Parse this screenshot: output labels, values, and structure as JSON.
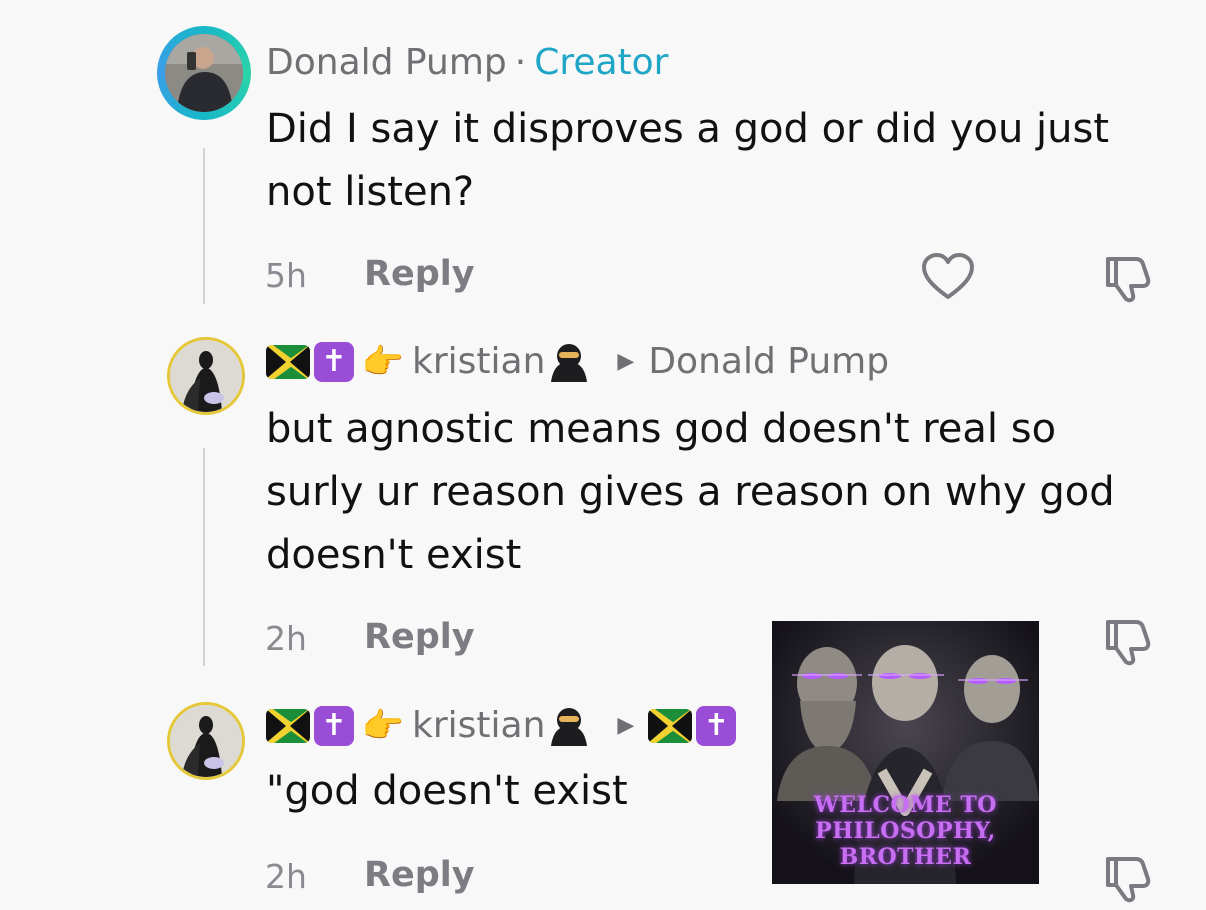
{
  "comments": [
    {
      "author": "Donald Pump",
      "separator": "·",
      "badge": "Creator",
      "text_lines": [
        "Did I say it disproves a god or did you just",
        "not listen?"
      ],
      "time": "5h",
      "reply_label": "Reply"
    },
    {
      "author": "kristian",
      "reply_to": "Donald Pump",
      "text_lines": [
        "but agnostic means god doesn't real so",
        "surly ur reason gives a reason on why god",
        "doesn't exist"
      ],
      "time": "2h",
      "reply_label": "Reply"
    },
    {
      "author": "kristian",
      "text_lines": [
        "\"god doesn't exist"
      ],
      "time": "2h",
      "reply_label": "Reply"
    }
  ],
  "meme": {
    "line1": "WELCOME TO",
    "line2": "PHILOSOPHY,",
    "line3": "BROTHER"
  },
  "colors": {
    "creator_badge": "#1fa6c6",
    "meme_text": "#c86ef2"
  },
  "icons": [
    "heart-icon",
    "dislike-icon",
    "play-arrow-icon",
    "jamaica-flag-emoji",
    "latin-cross-emoji",
    "pointing-hand-emoji",
    "ninja-emoji"
  ]
}
